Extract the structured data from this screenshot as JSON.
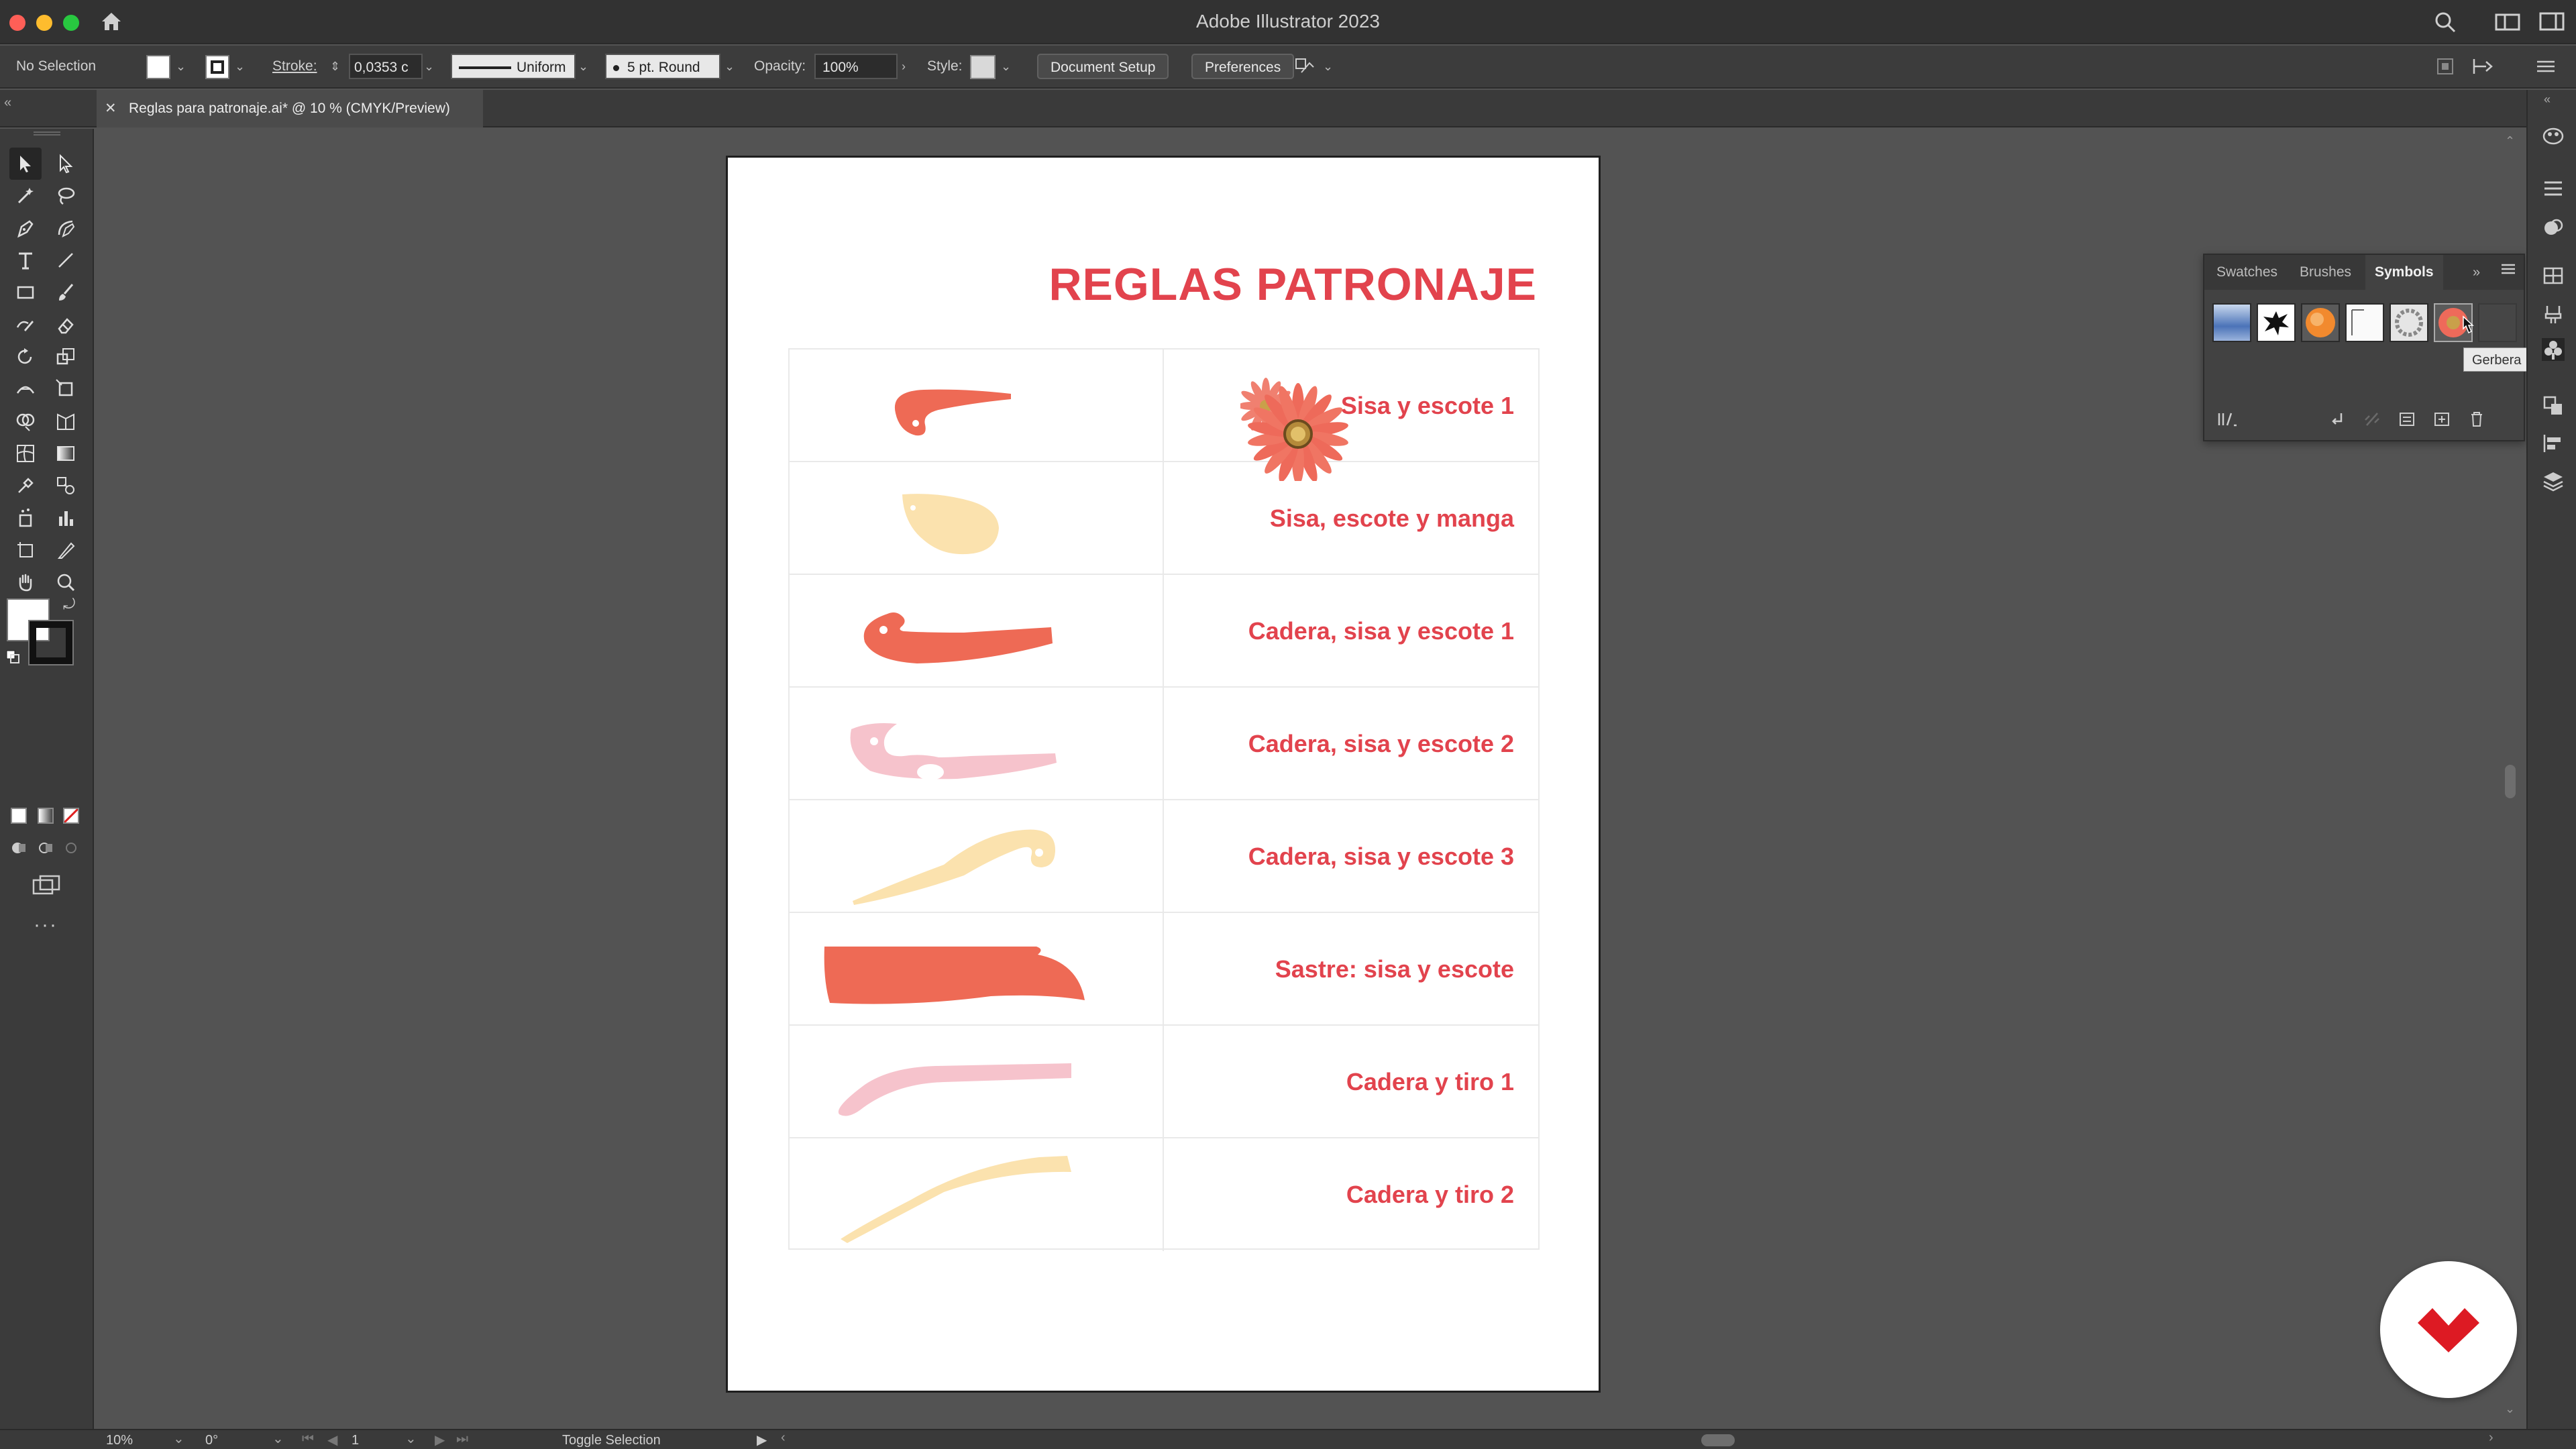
{
  "window": {
    "app_title": "Adobe Illustrator 2023"
  },
  "control_bar": {
    "selection_label": "No Selection",
    "stroke_label": "Stroke:",
    "stroke_value": "0,0353 c",
    "stroke_profile": "Uniform",
    "brush_value": "5 pt. Round",
    "opacity_label": "Opacity:",
    "opacity_value": "100%",
    "style_label": "Style:",
    "document_setup_label": "Document Setup",
    "preferences_label": "Preferences"
  },
  "document_tab": {
    "title": "Reglas para patronaje.ai* @ 10 % (CMYK/Preview)"
  },
  "artboard": {
    "title": "REGLAS PATRONAJE",
    "rows": [
      {
        "label": "Sisa y escote 1",
        "shape_color": "#ee6a55"
      },
      {
        "label": "Sisa, escote y manga",
        "shape_color": "#fbe2ae"
      },
      {
        "label": "Cadera, sisa y escote 1",
        "shape_color": "#ee6a55"
      },
      {
        "label": "Cadera, sisa y escote 2",
        "shape_color": "#f6c3cc"
      },
      {
        "label": "Cadera, sisa y escote 3",
        "shape_color": "#fbe2ae"
      },
      {
        "label": "Sastre: sisa y escote",
        "shape_color": "#ee6a55"
      },
      {
        "label": "Cadera y tiro 1",
        "shape_color": "#f6c3cc"
      },
      {
        "label": "Cadera y tiro 2",
        "shape_color": "#fbe2ae"
      }
    ]
  },
  "symbols_panel": {
    "tabs": [
      "Swatches",
      "Brushes",
      "Symbols"
    ],
    "active_tab": "Symbols",
    "tooltip": "Gerbera"
  },
  "status_bar": {
    "zoom": "10%",
    "rotation": "0°",
    "artboard_number": "1",
    "status_text": "Toggle Selection"
  },
  "colors": {
    "accent_red": "#e2434d",
    "coral": "#ee6a55",
    "cream": "#fbe2ae",
    "pink": "#f6c3cc",
    "brand_red": "#dd1a23"
  }
}
